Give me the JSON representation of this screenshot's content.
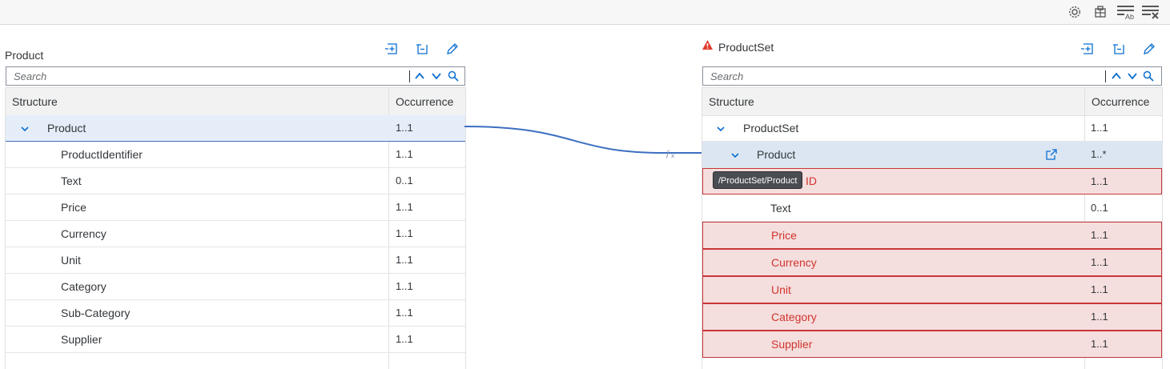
{
  "toolbar": {
    "icons": [
      "settings-icon",
      "mapping-table-icon",
      "format-text-icon",
      "clear-format-icon"
    ]
  },
  "left": {
    "title": "Product",
    "search_placeholder": "Search",
    "col_structure": "Structure",
    "col_occurrence": "Occurrence",
    "rows": [
      {
        "name": "Product",
        "occ": "1..1"
      },
      {
        "name": "ProductIdentifier",
        "occ": "1..1"
      },
      {
        "name": "Text",
        "occ": "0..1"
      },
      {
        "name": "Price",
        "occ": "1..1"
      },
      {
        "name": "Currency",
        "occ": "1..1"
      },
      {
        "name": "Unit",
        "occ": "1..1"
      },
      {
        "name": "Category",
        "occ": "1..1"
      },
      {
        "name": "Sub-Category",
        "occ": "1..1"
      },
      {
        "name": "Supplier",
        "occ": "1..1"
      }
    ]
  },
  "right": {
    "title": "ProductSet",
    "search_placeholder": "Search",
    "col_structure": "Structure",
    "col_occurrence": "Occurrence",
    "rows": [
      {
        "name": "ProductSet",
        "occ": "1..1"
      },
      {
        "name": "Product",
        "occ": "1..*"
      },
      {
        "name": "ID",
        "occ": "1..1"
      },
      {
        "name": "Text",
        "occ": "0..1"
      },
      {
        "name": "Price",
        "occ": "1..1"
      },
      {
        "name": "Currency",
        "occ": "1..1"
      },
      {
        "name": "Unit",
        "occ": "1..1"
      },
      {
        "name": "Category",
        "occ": "1..1"
      },
      {
        "name": "Supplier",
        "occ": "1..1"
      }
    ]
  },
  "tooltip": "/ProductSet/Product",
  "colors": {
    "accent": "#0a6ed1",
    "error": "#d0352e",
    "error_bg": "#f5dede",
    "mapping_line": "#3d6ec2"
  }
}
